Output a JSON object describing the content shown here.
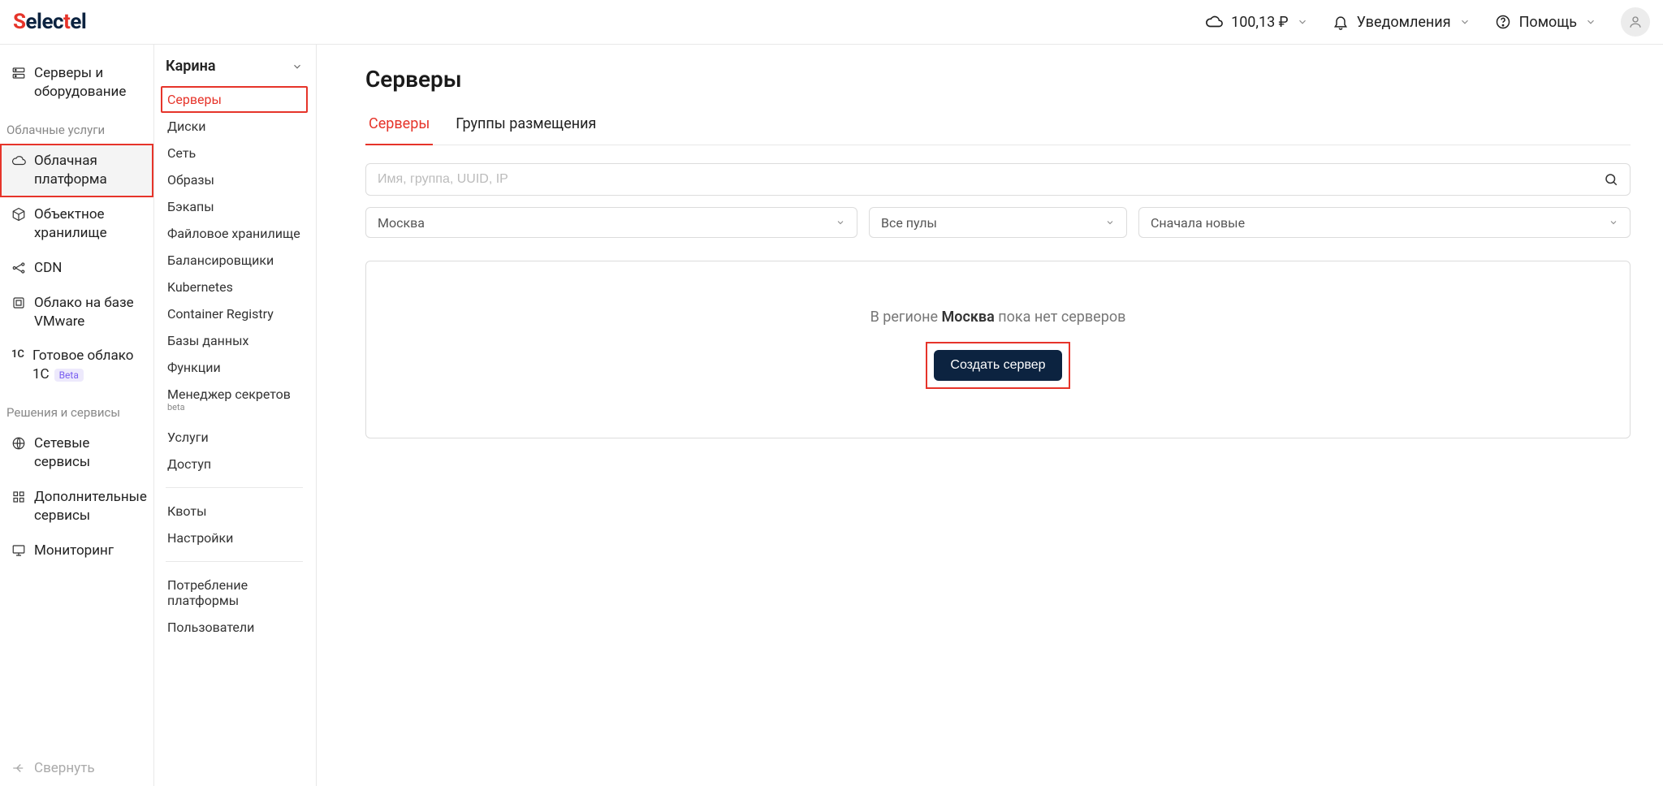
{
  "header": {
    "balance": "100,13 ₽",
    "notifications": "Уведомления",
    "help": "Помощь"
  },
  "sidebar1": {
    "servers": "Серверы и оборудование",
    "section_cloud": "Облачные услуги",
    "cloud_platform": "Облачная платформа",
    "object_storage": "Объектное хранилище",
    "cdn": "CDN",
    "vmware": "Облако на базе VMware",
    "ready_1c": "Готовое облако 1С",
    "section_solutions": "Решения и сервисы",
    "network": "Сетевые сервисы",
    "extra": "Дополнительные сервисы",
    "monitoring": "Мониторинг",
    "collapse": "Свернуть",
    "beta": "Beta"
  },
  "sidebar2": {
    "project": "Карина",
    "items": {
      "servers": "Серверы",
      "disks": "Диски",
      "network": "Сеть",
      "images": "Образы",
      "backups": "Бэкапы",
      "filestorage": "Файловое хранилище",
      "balancers": "Балансировщики",
      "kubernetes": "Kubernetes",
      "registry": "Container Registry",
      "databases": "Базы данных",
      "functions": "Функции",
      "secrets": "Менеджер секретов",
      "secrets_sup": "beta",
      "services": "Услуги",
      "access": "Доступ",
      "quotas": "Квоты",
      "settings": "Настройки",
      "consumption": "Потребление платформы",
      "users": "Пользователи"
    }
  },
  "main": {
    "title": "Серверы",
    "tabs": {
      "servers": "Серверы",
      "groups": "Группы размещения"
    },
    "search_placeholder": "Имя, группа, UUID, IP",
    "filters": {
      "region": "Москва",
      "pool": "Все пулы",
      "sort": "Сначала новые"
    },
    "empty": {
      "prefix": "В регионе ",
      "region": "Москва",
      "suffix": " пока нет серверов"
    },
    "create_button": "Создать сервер"
  }
}
